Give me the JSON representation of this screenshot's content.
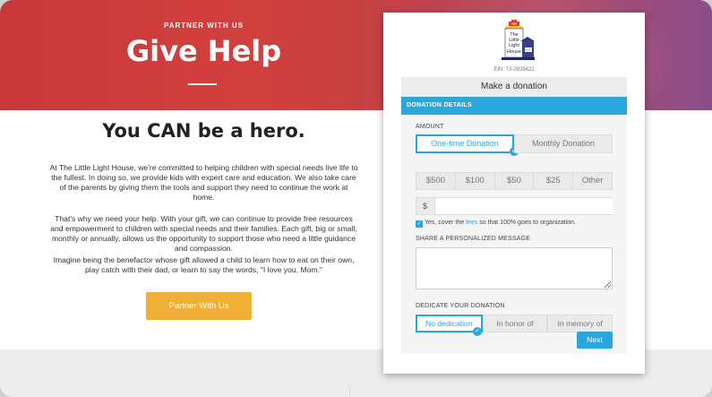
{
  "hero": {
    "eyebrow": "PARTNER WITH US",
    "title": "Give Help"
  },
  "intro": {
    "heading": "You CAN be a hero.",
    "paragraphs": [
      "At The Little Light House, we're committed to helping children with special needs live life to the fullest. In doing so, we provide kids with expert care and education. We also take care of the parents by giving them the tools and support they need to continue the work at home.",
      "That's why we need your help. With your gift, we can continue to provide free resources and empowerment to children with special needs and their families. Each gift, big or small, monthly or annually, allows us the opportunity to support those who need a little guidance and compassion.",
      "Imagine being the benefactor whose gift allowed a child to learn how to eat on their own, play catch with their dad, or learn to say the words, \"I love you, Mom.\""
    ],
    "partner_button": "Partner With Us"
  },
  "donation_form": {
    "logo_text": [
      "The",
      "Little",
      "Light",
      "House"
    ],
    "logo_badge": "Est.1972",
    "ein": "EIN: 73-0939422",
    "title": "Make a donation",
    "panel_header": "DONATION DETAILS",
    "amount_label": "AMOUNT",
    "frequency_options": [
      "One-time Donation",
      "Monthly Donation"
    ],
    "frequency_selected": "One-time Donation",
    "amount_options": [
      "$500",
      "$100",
      "$50",
      "$25",
      "Other"
    ],
    "currency_symbol": "$",
    "amount_value": "",
    "cover_fees": {
      "checked": true,
      "text_before": "Yes, cover the ",
      "link": "fees",
      "text_after": " so that 100% goes to organization."
    },
    "message_label": "SHARE A PERSONALIZED MESSAGE",
    "message_value": "",
    "dedicate_label": "DEDICATE YOUR DONATION",
    "dedicate_options": [
      "No dedication",
      "In honor of",
      "In memory of"
    ],
    "dedicate_selected": "No dedication",
    "next_button": "Next"
  },
  "colors": {
    "accent_blue": "#2ba6dc",
    "cta_orange": "#f0ae36",
    "hero_red": "#c8383a"
  }
}
